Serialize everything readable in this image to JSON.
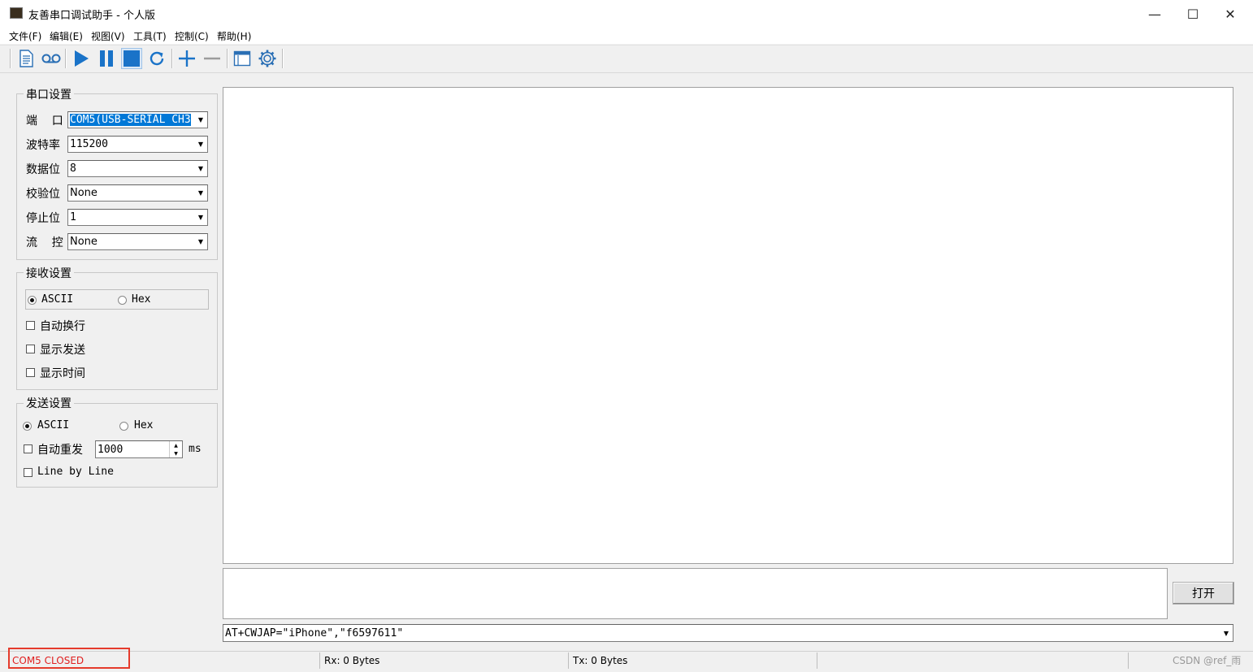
{
  "window": {
    "title": "友善串口调试助手 - 个人版",
    "minimize": "—",
    "maximize": "☐",
    "close": "✕"
  },
  "menu": [
    "文件(F)",
    "编辑(E)",
    "视图(V)",
    "工具(T)",
    "控制(C)",
    "帮助(H)"
  ],
  "serial_settings": {
    "title": "串口设置",
    "fields": [
      {
        "label": "端    口",
        "value": "COM5(USB-SERIAL CH3"
      },
      {
        "label": "波特率",
        "value": "115200"
      },
      {
        "label": "数据位",
        "value": "8"
      },
      {
        "label": "校验位",
        "value": "None"
      },
      {
        "label": "停止位",
        "value": "1"
      },
      {
        "label": "流    控",
        "value": "None"
      }
    ]
  },
  "receive_settings": {
    "title": "接收设置",
    "mode_ascii": "ASCII",
    "mode_hex": "Hex",
    "selected": "ASCII",
    "options": [
      "自动换行",
      "显示发送",
      "显示时间"
    ]
  },
  "send_settings": {
    "title": "发送设置",
    "mode_ascii": "ASCII",
    "mode_hex": "Hex",
    "selected": "ASCII",
    "auto_resend_label": "自动重发",
    "interval": "1000",
    "interval_unit": "ms",
    "line_by_line": "Line by Line"
  },
  "open_button": "打开",
  "command_value": "AT+CWJAP=\"iPhone\",\"f6597611\"",
  "status": {
    "port_state": "COM5 CLOSED",
    "rx": "Rx: 0 Bytes",
    "tx": "Tx: 0 Bytes",
    "watermark": "CSDN @ref_雨"
  },
  "colors": {
    "accent": "#1a73c8",
    "status_highlight": "#e53b2c",
    "port_state_text": "#e02020"
  }
}
